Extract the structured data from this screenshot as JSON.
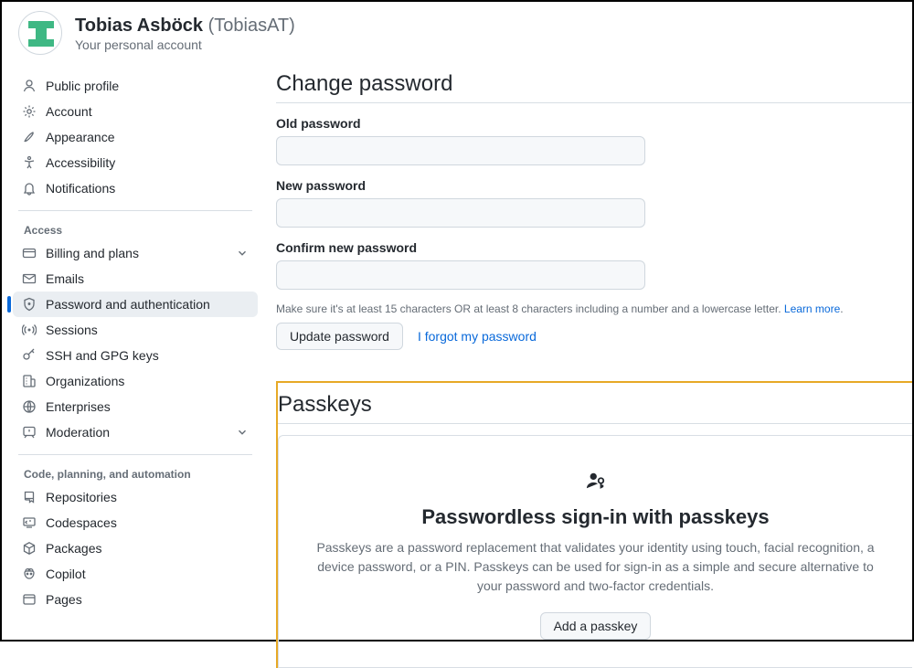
{
  "header": {
    "display_name": "Tobias Asböck",
    "username": "TobiasAT",
    "subtitle": "Your personal account"
  },
  "sidebar": {
    "top": [
      {
        "icon": "person",
        "label": "Public profile"
      },
      {
        "icon": "gear",
        "label": "Account"
      },
      {
        "icon": "brush",
        "label": "Appearance"
      },
      {
        "icon": "a11y",
        "label": "Accessibility"
      },
      {
        "icon": "bell",
        "label": "Notifications"
      }
    ],
    "access_label": "Access",
    "access": [
      {
        "icon": "credit",
        "label": "Billing and plans",
        "expandable": true
      },
      {
        "icon": "mail",
        "label": "Emails"
      },
      {
        "icon": "shield",
        "label": "Password and authentication",
        "active": true
      },
      {
        "icon": "broadcast",
        "label": "Sessions"
      },
      {
        "icon": "key",
        "label": "SSH and GPG keys"
      },
      {
        "icon": "org",
        "label": "Organizations"
      },
      {
        "icon": "globe",
        "label": "Enterprises"
      },
      {
        "icon": "report",
        "label": "Moderation",
        "expandable": true
      }
    ],
    "code_label": "Code, planning, and automation",
    "code": [
      {
        "icon": "repo",
        "label": "Repositories"
      },
      {
        "icon": "codespace",
        "label": "Codespaces"
      },
      {
        "icon": "package",
        "label": "Packages"
      },
      {
        "icon": "copilot",
        "label": "Copilot"
      },
      {
        "icon": "browser",
        "label": "Pages"
      }
    ]
  },
  "change_password": {
    "title": "Change password",
    "old_label": "Old password",
    "new_label": "New password",
    "confirm_label": "Confirm new password",
    "hint_text": "Make sure it's at least 15 characters OR at least 8 characters including a number and a lowercase letter. ",
    "hint_link": "Learn more",
    "update_button": "Update password",
    "forgot_link": "I forgot my password"
  },
  "passkeys": {
    "title": "Passkeys",
    "heading": "Passwordless sign-in with passkeys",
    "description": "Passkeys are a password replacement that validates your identity using touch, facial recognition, a device password, or a PIN. Passkeys can be used for sign-in as a simple and secure alternative to your password and two-factor credentials.",
    "add_button": "Add a passkey"
  }
}
